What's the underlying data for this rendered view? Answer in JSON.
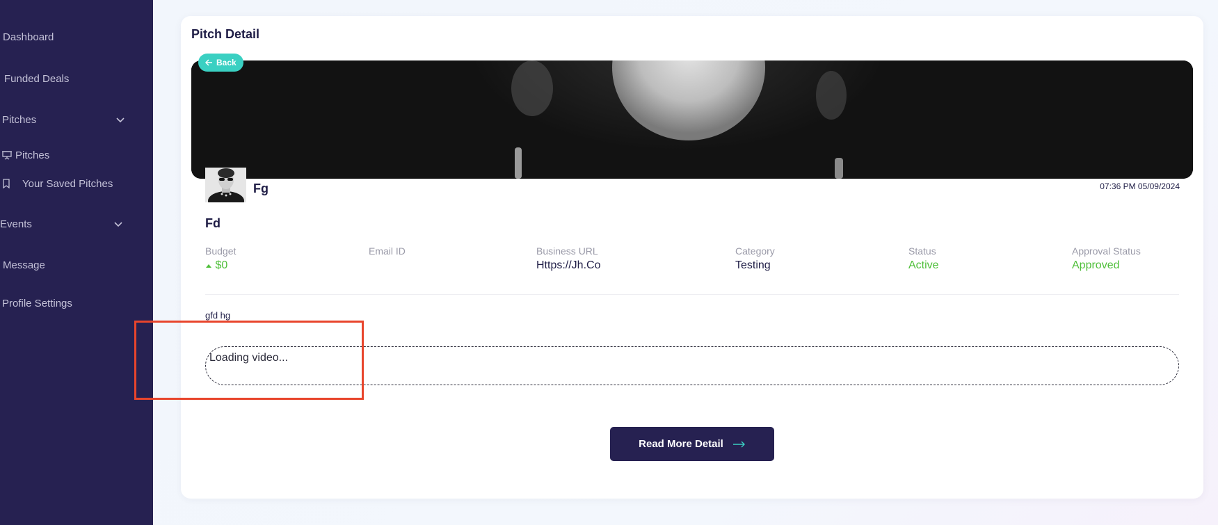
{
  "sidebar": {
    "items": [
      {
        "label": "Dashboard"
      },
      {
        "label": "Funded Deals"
      },
      {
        "label": "Pitches"
      },
      {
        "label": "Pitches"
      },
      {
        "label": "Your Saved Pitches"
      },
      {
        "label": "Events"
      },
      {
        "label": "Message"
      },
      {
        "label": "Profile Settings"
      }
    ]
  },
  "page": {
    "title": "Pitch Detail",
    "back_label": "Back"
  },
  "pitch": {
    "owner_name": "Fg",
    "timestamp": "07:36 PM 05/09/2024",
    "title": "Fd",
    "fields": [
      {
        "label": "Budget",
        "value": "$0"
      },
      {
        "label": "Email ID",
        "value": ""
      },
      {
        "label": "Business URL",
        "value": "Https://Jh.Co"
      },
      {
        "label": "Category",
        "value": "Testing"
      },
      {
        "label": "Status",
        "value": "Active"
      },
      {
        "label": "Approval Status",
        "value": "Approved"
      }
    ],
    "description": "gfd hg",
    "video_status": "Loading video...",
    "read_more_label": "Read More Detail"
  },
  "colors": {
    "sidebar_bg": "#262151",
    "accent_teal": "#3ad0c2",
    "status_green": "#4fbf3a",
    "highlight_red": "#e8452c"
  }
}
